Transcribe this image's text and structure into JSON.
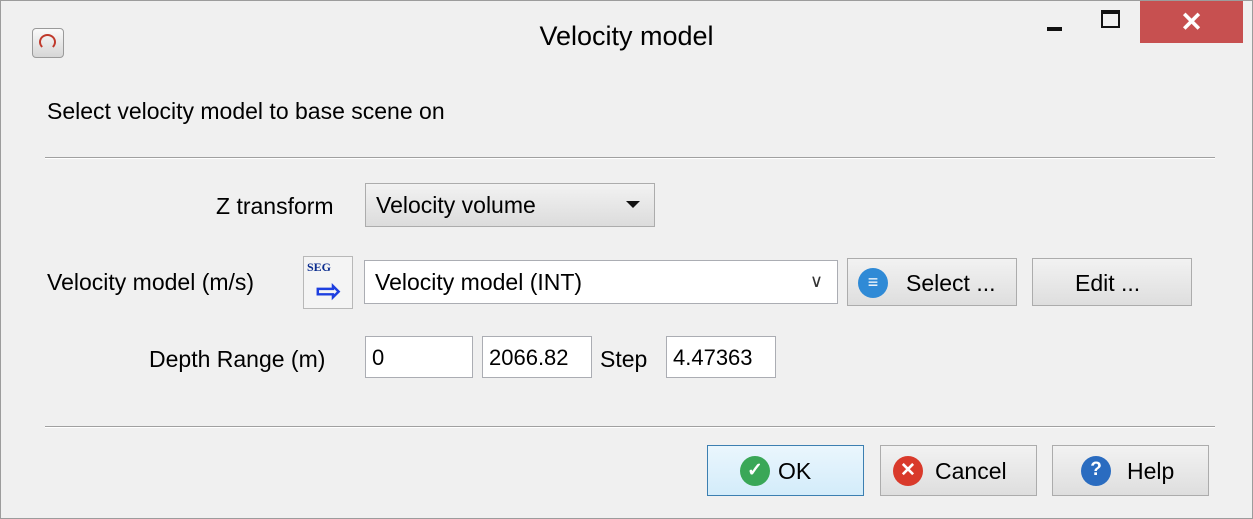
{
  "window": {
    "title": "Velocity model",
    "close_symbol": "✕"
  },
  "header": {
    "instruction": "Select velocity model to base scene on"
  },
  "z_transform": {
    "label": "Z transform",
    "value": "Velocity volume"
  },
  "velocity_model": {
    "label": "Velocity model (m/s)",
    "segy_icon_text": "SEG",
    "value": "Velocity model (INT)",
    "select_label": "Select ...",
    "edit_label": "Edit ..."
  },
  "depth_range": {
    "label": "Depth Range (m)",
    "start": "0",
    "stop": "2066.82",
    "step_label": "Step",
    "step": "4.47363"
  },
  "footer": {
    "ok_label": "OK",
    "cancel_label": "Cancel",
    "help_label": "Help"
  },
  "colors": {
    "close_red": "#c75050",
    "ok_green": "#3aa757",
    "cancel_red": "#d93a2b",
    "help_blue": "#2a6cc0",
    "select_blue": "#2f8ad6"
  },
  "icons": [
    "app-icon",
    "minimize-icon",
    "maximize-icon",
    "close-icon",
    "segy-import-icon",
    "dropdown-caret-icon",
    "chevron-down-icon",
    "list-icon",
    "check-icon",
    "cancel-icon",
    "help-icon"
  ]
}
